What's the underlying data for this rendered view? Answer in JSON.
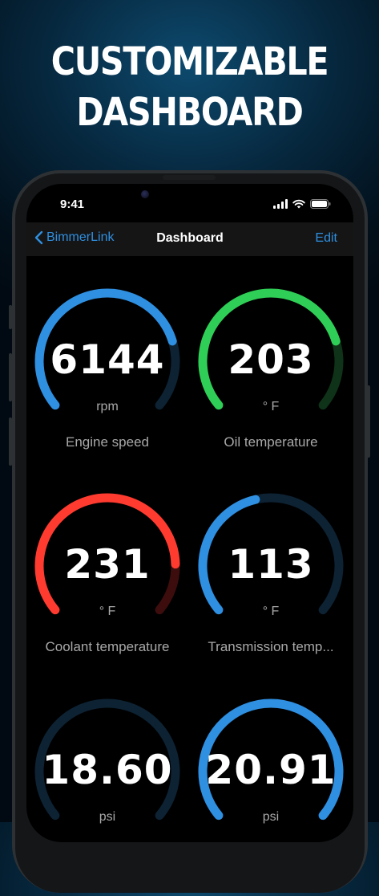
{
  "headline": {
    "line1": "CUSTOMIZABLE",
    "line2": "DASHBOARD"
  },
  "status_bar": {
    "time": "9:41"
  },
  "nav": {
    "back_label": "BimmerLink",
    "title": "Dashboard",
    "edit_label": "Edit"
  },
  "colors": {
    "blue": "#2f8fe0",
    "green": "#2fcf57",
    "red": "#ff3b30"
  },
  "gauges": [
    {
      "value": "6144",
      "unit": "rpm",
      "name": "Engine speed",
      "color": "blue",
      "level": 0.78
    },
    {
      "value": "203",
      "unit": "° F",
      "name": "Oil temperature",
      "color": "green",
      "level": 0.78
    },
    {
      "value": "231",
      "unit": "° F",
      "name": "Coolant temperature",
      "color": "red",
      "level": 0.84
    },
    {
      "value": "113",
      "unit": "° F",
      "name": "Transmission temp...",
      "color": "blue",
      "level": 0.45
    },
    {
      "value": "18.60",
      "unit": "psi",
      "name": "",
      "color": "blue",
      "level": 0.0
    },
    {
      "value": "20.91",
      "unit": "psi",
      "name": "",
      "color": "blue",
      "level": 1.0
    }
  ]
}
